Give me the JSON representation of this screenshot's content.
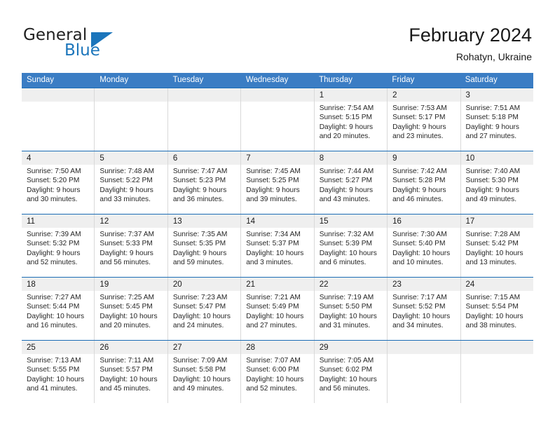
{
  "logo": {
    "text_primary": "General",
    "text_secondary": "Blue",
    "triangle_icon": "triangle-icon",
    "accent_color": "#1b75bb"
  },
  "header": {
    "title": "February 2024",
    "location": "Rohatyn, Ukraine"
  },
  "colors": {
    "header_row_bg": "#3b7dc4",
    "week_divider": "#1b6cb5",
    "day_band_bg": "#efefef",
    "brand_blue": "#1b75bb"
  },
  "weekday_headers": [
    "Sunday",
    "Monday",
    "Tuesday",
    "Wednesday",
    "Thursday",
    "Friday",
    "Saturday"
  ],
  "weeks": [
    [
      {
        "day": "",
        "sunrise": "",
        "sunset": "",
        "daylight_1": "",
        "daylight_2": ""
      },
      {
        "day": "",
        "sunrise": "",
        "sunset": "",
        "daylight_1": "",
        "daylight_2": ""
      },
      {
        "day": "",
        "sunrise": "",
        "sunset": "",
        "daylight_1": "",
        "daylight_2": ""
      },
      {
        "day": "",
        "sunrise": "",
        "sunset": "",
        "daylight_1": "",
        "daylight_2": ""
      },
      {
        "day": "1",
        "sunrise": "Sunrise: 7:54 AM",
        "sunset": "Sunset: 5:15 PM",
        "daylight_1": "Daylight: 9 hours",
        "daylight_2": "and 20 minutes."
      },
      {
        "day": "2",
        "sunrise": "Sunrise: 7:53 AM",
        "sunset": "Sunset: 5:17 PM",
        "daylight_1": "Daylight: 9 hours",
        "daylight_2": "and 23 minutes."
      },
      {
        "day": "3",
        "sunrise": "Sunrise: 7:51 AM",
        "sunset": "Sunset: 5:18 PM",
        "daylight_1": "Daylight: 9 hours",
        "daylight_2": "and 27 minutes."
      }
    ],
    [
      {
        "day": "4",
        "sunrise": "Sunrise: 7:50 AM",
        "sunset": "Sunset: 5:20 PM",
        "daylight_1": "Daylight: 9 hours",
        "daylight_2": "and 30 minutes."
      },
      {
        "day": "5",
        "sunrise": "Sunrise: 7:48 AM",
        "sunset": "Sunset: 5:22 PM",
        "daylight_1": "Daylight: 9 hours",
        "daylight_2": "and 33 minutes."
      },
      {
        "day": "6",
        "sunrise": "Sunrise: 7:47 AM",
        "sunset": "Sunset: 5:23 PM",
        "daylight_1": "Daylight: 9 hours",
        "daylight_2": "and 36 minutes."
      },
      {
        "day": "7",
        "sunrise": "Sunrise: 7:45 AM",
        "sunset": "Sunset: 5:25 PM",
        "daylight_1": "Daylight: 9 hours",
        "daylight_2": "and 39 minutes."
      },
      {
        "day": "8",
        "sunrise": "Sunrise: 7:44 AM",
        "sunset": "Sunset: 5:27 PM",
        "daylight_1": "Daylight: 9 hours",
        "daylight_2": "and 43 minutes."
      },
      {
        "day": "9",
        "sunrise": "Sunrise: 7:42 AM",
        "sunset": "Sunset: 5:28 PM",
        "daylight_1": "Daylight: 9 hours",
        "daylight_2": "and 46 minutes."
      },
      {
        "day": "10",
        "sunrise": "Sunrise: 7:40 AM",
        "sunset": "Sunset: 5:30 PM",
        "daylight_1": "Daylight: 9 hours",
        "daylight_2": "and 49 minutes."
      }
    ],
    [
      {
        "day": "11",
        "sunrise": "Sunrise: 7:39 AM",
        "sunset": "Sunset: 5:32 PM",
        "daylight_1": "Daylight: 9 hours",
        "daylight_2": "and 52 minutes."
      },
      {
        "day": "12",
        "sunrise": "Sunrise: 7:37 AM",
        "sunset": "Sunset: 5:33 PM",
        "daylight_1": "Daylight: 9 hours",
        "daylight_2": "and 56 minutes."
      },
      {
        "day": "13",
        "sunrise": "Sunrise: 7:35 AM",
        "sunset": "Sunset: 5:35 PM",
        "daylight_1": "Daylight: 9 hours",
        "daylight_2": "and 59 minutes."
      },
      {
        "day": "14",
        "sunrise": "Sunrise: 7:34 AM",
        "sunset": "Sunset: 5:37 PM",
        "daylight_1": "Daylight: 10 hours",
        "daylight_2": "and 3 minutes."
      },
      {
        "day": "15",
        "sunrise": "Sunrise: 7:32 AM",
        "sunset": "Sunset: 5:39 PM",
        "daylight_1": "Daylight: 10 hours",
        "daylight_2": "and 6 minutes."
      },
      {
        "day": "16",
        "sunrise": "Sunrise: 7:30 AM",
        "sunset": "Sunset: 5:40 PM",
        "daylight_1": "Daylight: 10 hours",
        "daylight_2": "and 10 minutes."
      },
      {
        "day": "17",
        "sunrise": "Sunrise: 7:28 AM",
        "sunset": "Sunset: 5:42 PM",
        "daylight_1": "Daylight: 10 hours",
        "daylight_2": "and 13 minutes."
      }
    ],
    [
      {
        "day": "18",
        "sunrise": "Sunrise: 7:27 AM",
        "sunset": "Sunset: 5:44 PM",
        "daylight_1": "Daylight: 10 hours",
        "daylight_2": "and 16 minutes."
      },
      {
        "day": "19",
        "sunrise": "Sunrise: 7:25 AM",
        "sunset": "Sunset: 5:45 PM",
        "daylight_1": "Daylight: 10 hours",
        "daylight_2": "and 20 minutes."
      },
      {
        "day": "20",
        "sunrise": "Sunrise: 7:23 AM",
        "sunset": "Sunset: 5:47 PM",
        "daylight_1": "Daylight: 10 hours",
        "daylight_2": "and 24 minutes."
      },
      {
        "day": "21",
        "sunrise": "Sunrise: 7:21 AM",
        "sunset": "Sunset: 5:49 PM",
        "daylight_1": "Daylight: 10 hours",
        "daylight_2": "and 27 minutes."
      },
      {
        "day": "22",
        "sunrise": "Sunrise: 7:19 AM",
        "sunset": "Sunset: 5:50 PM",
        "daylight_1": "Daylight: 10 hours",
        "daylight_2": "and 31 minutes."
      },
      {
        "day": "23",
        "sunrise": "Sunrise: 7:17 AM",
        "sunset": "Sunset: 5:52 PM",
        "daylight_1": "Daylight: 10 hours",
        "daylight_2": "and 34 minutes."
      },
      {
        "day": "24",
        "sunrise": "Sunrise: 7:15 AM",
        "sunset": "Sunset: 5:54 PM",
        "daylight_1": "Daylight: 10 hours",
        "daylight_2": "and 38 minutes."
      }
    ],
    [
      {
        "day": "25",
        "sunrise": "Sunrise: 7:13 AM",
        "sunset": "Sunset: 5:55 PM",
        "daylight_1": "Daylight: 10 hours",
        "daylight_2": "and 41 minutes."
      },
      {
        "day": "26",
        "sunrise": "Sunrise: 7:11 AM",
        "sunset": "Sunset: 5:57 PM",
        "daylight_1": "Daylight: 10 hours",
        "daylight_2": "and 45 minutes."
      },
      {
        "day": "27",
        "sunrise": "Sunrise: 7:09 AM",
        "sunset": "Sunset: 5:58 PM",
        "daylight_1": "Daylight: 10 hours",
        "daylight_2": "and 49 minutes."
      },
      {
        "day": "28",
        "sunrise": "Sunrise: 7:07 AM",
        "sunset": "Sunset: 6:00 PM",
        "daylight_1": "Daylight: 10 hours",
        "daylight_2": "and 52 minutes."
      },
      {
        "day": "29",
        "sunrise": "Sunrise: 7:05 AM",
        "sunset": "Sunset: 6:02 PM",
        "daylight_1": "Daylight: 10 hours",
        "daylight_2": "and 56 minutes."
      },
      {
        "day": "",
        "sunrise": "",
        "sunset": "",
        "daylight_1": "",
        "daylight_2": ""
      },
      {
        "day": "",
        "sunrise": "",
        "sunset": "",
        "daylight_1": "",
        "daylight_2": ""
      }
    ]
  ]
}
